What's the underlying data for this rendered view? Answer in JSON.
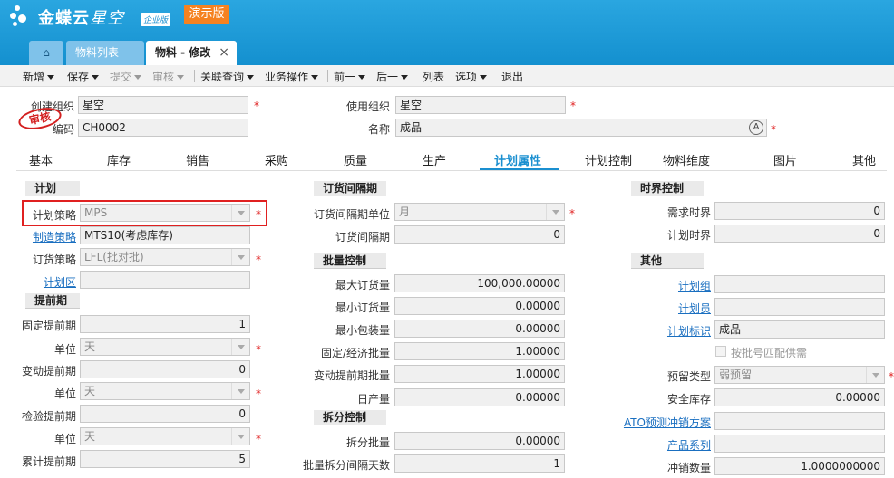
{
  "app": {
    "name": "金蝶云",
    "name2": "星空",
    "edition": "企业版",
    "demo": "演示版"
  },
  "tabs": {
    "list": "物料列表",
    "edit": "物料 - 修改",
    "close": "×"
  },
  "toolbar": [
    "新增",
    "保存",
    "提交",
    "审核",
    "关联查询",
    "业务操作",
    "前一",
    "后一",
    "列表",
    "选项",
    "退出"
  ],
  "header": {
    "create_org_label": "创建组织",
    "create_org": "星空",
    "use_org_label": "使用组织",
    "use_org": "星空",
    "code_label": "编码",
    "code": "CH0002",
    "name_label": "名称",
    "name": "成品",
    "stamp": "审核"
  },
  "form_tabs": [
    "基本",
    "库存",
    "销售",
    "采购",
    "质量",
    "生产",
    "计划属性",
    "计划控制",
    "物料维度",
    "图片",
    "其他"
  ],
  "plan": {
    "title": "计划",
    "strategy_label": "计划策略",
    "strategy": "MPS",
    "mfg_label": "制造策略",
    "mfg": "MTS10(考虑库存)",
    "order_label": "订货策略",
    "order": "LFL(批对批)",
    "zone_label": "计划区",
    "zone": ""
  },
  "lead": {
    "title": "提前期",
    "fixed_label": "固定提前期",
    "fixed": "1",
    "unit_label": "单位",
    "unit1": "天",
    "var_label": "变动提前期",
    "var": "0",
    "unit2": "天",
    "insp_label": "检验提前期",
    "insp": "0",
    "unit3": "天",
    "cum_label": "累计提前期",
    "cum": "5"
  },
  "interval": {
    "title": "订货间隔期",
    "unit_label": "订货间隔期单位",
    "unit": "月",
    "period_label": "订货间隔期",
    "period": "0"
  },
  "batch": {
    "title": "批量控制",
    "max_label": "最大订货量",
    "max": "100,000.00000",
    "min_label": "最小订货量",
    "min": "0.00000",
    "pack_label": "最小包装量",
    "pack": "0.00000",
    "eco_label": "固定/经济批量",
    "eco": "1.00000",
    "var_label": "变动提前期批量",
    "var": "1.00000",
    "daily_label": "日产量",
    "daily": "0.00000"
  },
  "split": {
    "title": "拆分控制",
    "qty_label": "拆分批量",
    "qty": "0.00000",
    "days_label": "批量拆分间隔天数",
    "days": "1"
  },
  "horizon": {
    "title": "时界控制",
    "demand_label": "需求时界",
    "demand": "0",
    "plan_label": "计划时界",
    "plan": "0"
  },
  "other": {
    "title": "其他",
    "group_label": "计划组",
    "group": "",
    "planner_label": "计划员",
    "planner": "",
    "mark_label": "计划标识",
    "mark": "成品",
    "lot_label": "按批号匹配供需",
    "reserve_label": "预留类型",
    "reserve": "弱预留",
    "safety_label": "安全库存",
    "safety": "0.00000",
    "ato_label": "ATO预测冲销方案",
    "ato": "",
    "series_label": "产品系列",
    "series": "",
    "offset_label": "冲销数量",
    "offset": "1.0000000000"
  }
}
